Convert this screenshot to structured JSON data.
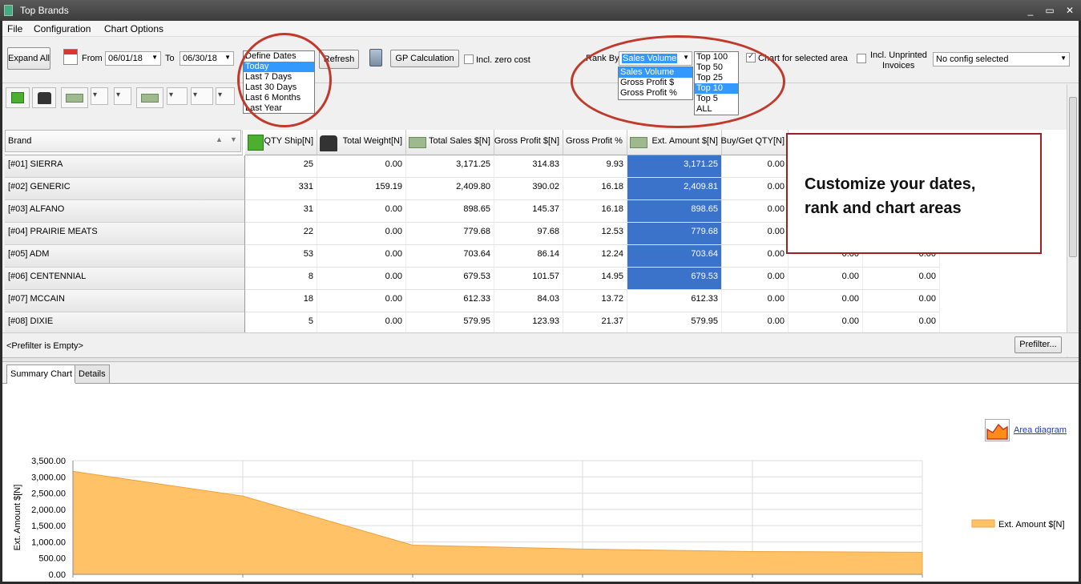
{
  "window": {
    "title": "Top Brands"
  },
  "menu": [
    "File",
    "Configuration",
    "Chart Options"
  ],
  "toolbar": {
    "expand_all": "Expand All",
    "from_label": "From",
    "from_value": "06/01/18",
    "to_label": "To",
    "to_value": "06/30/18",
    "date_preset_options": [
      "Define Dates",
      "Today",
      "Last 7 Days",
      "Last 30 Days",
      "Last 6 Months",
      "Last Year"
    ],
    "date_preset_selected": "Today",
    "refresh": "Refresh",
    "gp_calculation": "GP Calculation",
    "incl_zero_cost": "Incl. zero cost",
    "rank_by_label": "Rank By",
    "rank_by_value": "Sales Volume",
    "rank_by_options": [
      "Sales Volume",
      "Gross Profit $",
      "Gross Profit %"
    ],
    "top_options": [
      "Top 100",
      "Top 50",
      "Top 25",
      "Top 10",
      "Top 5",
      "ALL"
    ],
    "top_selected": "Top 10",
    "chart_for_selected_area": "Chart for selected area",
    "incl_unprinted_line1": "Incl. Unprinted",
    "incl_unprinted_line2": "Invoices",
    "config_value": "No config selected"
  },
  "grid": {
    "columns": [
      "Brand",
      "QTY Ship[N]",
      "Total Weight[N]",
      "Total Sales $[N]",
      "Gross Profit $[N]",
      "Gross Profit %",
      "Ext. Amount $[N]",
      "Buy/Get QTY[N]"
    ],
    "rows": [
      {
        "brand": "[#01] SIERRA",
        "qty": "25",
        "weight": "0.00",
        "sales": "3,171.25",
        "gp": "314.83",
        "gpp": "9.93",
        "ext": "3,171.25",
        "bg": "0.00",
        "c9": "",
        "c10": ""
      },
      {
        "brand": "[#02] GENERIC",
        "qty": "331",
        "weight": "159.19",
        "sales": "2,409.80",
        "gp": "390.02",
        "gpp": "16.18",
        "ext": "2,409.81",
        "bg": "0.00",
        "c9": "",
        "c10": ""
      },
      {
        "brand": "[#03] ALFANO",
        "qty": "31",
        "weight": "0.00",
        "sales": "898.65",
        "gp": "145.37",
        "gpp": "16.18",
        "ext": "898.65",
        "bg": "0.00",
        "c9": "",
        "c10": ""
      },
      {
        "brand": "[#04] PRAIRIE MEATS",
        "qty": "22",
        "weight": "0.00",
        "sales": "779.68",
        "gp": "97.68",
        "gpp": "12.53",
        "ext": "779.68",
        "bg": "0.00",
        "c9": "",
        "c10": ""
      },
      {
        "brand": "[#05] ADM",
        "qty": "53",
        "weight": "0.00",
        "sales": "703.64",
        "gp": "86.14",
        "gpp": "12.24",
        "ext": "703.64",
        "bg": "0.00",
        "c9": "0.00",
        "c10": "0.00"
      },
      {
        "brand": "[#06] CENTENNIAL",
        "qty": "8",
        "weight": "0.00",
        "sales": "679.53",
        "gp": "101.57",
        "gpp": "14.95",
        "ext": "679.53",
        "bg": "0.00",
        "c9": "0.00",
        "c10": "0.00"
      },
      {
        "brand": "[#07] MCCAIN",
        "qty": "18",
        "weight": "0.00",
        "sales": "612.33",
        "gp": "84.03",
        "gpp": "13.72",
        "ext": "612.33",
        "bg": "0.00",
        "c9": "0.00",
        "c10": "0.00"
      },
      {
        "brand": "[#08] DIXIE",
        "qty": "5",
        "weight": "0.00",
        "sales": "579.95",
        "gp": "123.93",
        "gpp": "21.37",
        "ext": "579.95",
        "bg": "0.00",
        "c9": "0.00",
        "c10": "0.00"
      }
    ]
  },
  "prefilter": {
    "status": "<Prefilter is Empty>",
    "button": "Prefilter..."
  },
  "tabs": [
    "Summary Chart",
    "Details"
  ],
  "chart_options": {
    "area_diagram": "Area diagram"
  },
  "callout": {
    "line1": "Customize your dates,",
    "line2": "rank and chart areas"
  },
  "colors": {
    "area_fill": "#ffc266",
    "selection": "#3a73c9",
    "highlight": "#c0392b"
  },
  "chart_data": {
    "type": "area",
    "categories": [
      "[#01] SIERRA",
      "[#02] GENERIC",
      "[#03] ALFANO",
      "[#04] PRAIRIE MEATS",
      "[#05] ADM",
      "[#06] CENTENNIAL"
    ],
    "series": [
      {
        "name": "Ext. Amount $[N]",
        "values": [
          3171.25,
          2409.81,
          898.65,
          779.68,
          703.64,
          679.53
        ]
      }
    ],
    "ylabel": "Ext. Amount $[N]",
    "xlabel": "",
    "ylim": [
      0,
      3500
    ],
    "yticks": [
      "0.00",
      "500.00",
      "1,000.00",
      "1,500.00",
      "2,000.00",
      "2,500.00",
      "3,000.00",
      "3,500.00"
    ],
    "grid": true,
    "legend": "right"
  }
}
